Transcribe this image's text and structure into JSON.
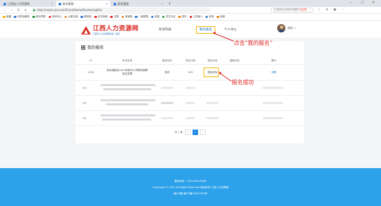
{
  "browser": {
    "tabs": [
      {
        "label": "江西省人力资源网",
        "active": false
      },
      {
        "label": "报名管理",
        "active": true
      },
      {
        "label": "报名管理",
        "active": false
      }
    ],
    "new_tab": "+",
    "window_controls": "— ▢ ✕",
    "url": "http://exam.jxrl.com/Front/Home/Exammng/list",
    "search_placeholder": "在用搜索证明材料需要",
    "search_hot": "热点搜",
    "toolbar_icons": "☆ ⬇ ▣ ⋯",
    "bookmarks": [
      {
        "label": "收藏",
        "color": "#f5b400"
      },
      {
        "label": "手机收藏夹",
        "color": "#2f7ad8"
      },
      {
        "label": "网址导航",
        "color": "#2c9e4b"
      },
      {
        "label": "游戏中心",
        "color": "#e33"
      },
      {
        "label": "火影忍者",
        "color": "#f08a24"
      },
      {
        "label": "建网站",
        "color": "#2f7ad8"
      },
      {
        "label": "京东商城",
        "color": "#e33"
      },
      {
        "label": "天猫",
        "color": "#e33"
      },
      {
        "label": "淘宝网",
        "color": "#f08a24"
      },
      {
        "label": "一键修复",
        "color": "#2f7ad8"
      },
      {
        "label": "百度",
        "color": "#2f7ad8"
      },
      {
        "label": "学生专区",
        "color": "#2c9e4b"
      },
      {
        "label": "菜鸟",
        "color": "#f08a24"
      },
      {
        "label": "江西省人",
        "color": "#d7261e"
      },
      {
        "label": "网页",
        "color": "#2f7ad8"
      },
      {
        "label": "淘宝",
        "color": "#f08a24"
      }
    ]
  },
  "site": {
    "logo_title": "江西人力资源网",
    "logo_sub": "江西省人力资源服务第一品牌",
    "nav": {
      "exam": "考试列表",
      "mine": "我的报名",
      "center": "个人中心"
    },
    "user_name": "测试",
    "user_caret": "▾"
  },
  "panel": {
    "title": "我的报名",
    "title_icon": "▣",
    "headers": {
      "id": "ID",
      "exam_name": "考试名称",
      "post_name": "报考岗位",
      "code": "岗位代码",
      "status": "报名状态",
      "pay_status": "缴费状态",
      "action": "操作"
    },
    "row1": {
      "id": "1124",
      "exam_name_1": "新余高新区2021年新中小学教师招聘",
      "exam_name_2": "招生发展",
      "post": "测试",
      "code": "101",
      "status": "报名成功",
      "action": "详情"
    }
  },
  "annotations": {
    "click_mine": "点击“我的报名”",
    "signup_success": "报名成功"
  },
  "pager": {
    "total": "共 1 条",
    "prev": "‹",
    "page": "1",
    "next": "›"
  },
  "footer": {
    "line1": "服务热线：0791-86109065",
    "line2": "Copyright © 2021 All Rights Reserved 版权所有 江西人力资源网",
    "line3": "赣ICP备 赣ICP备13001593号"
  }
}
